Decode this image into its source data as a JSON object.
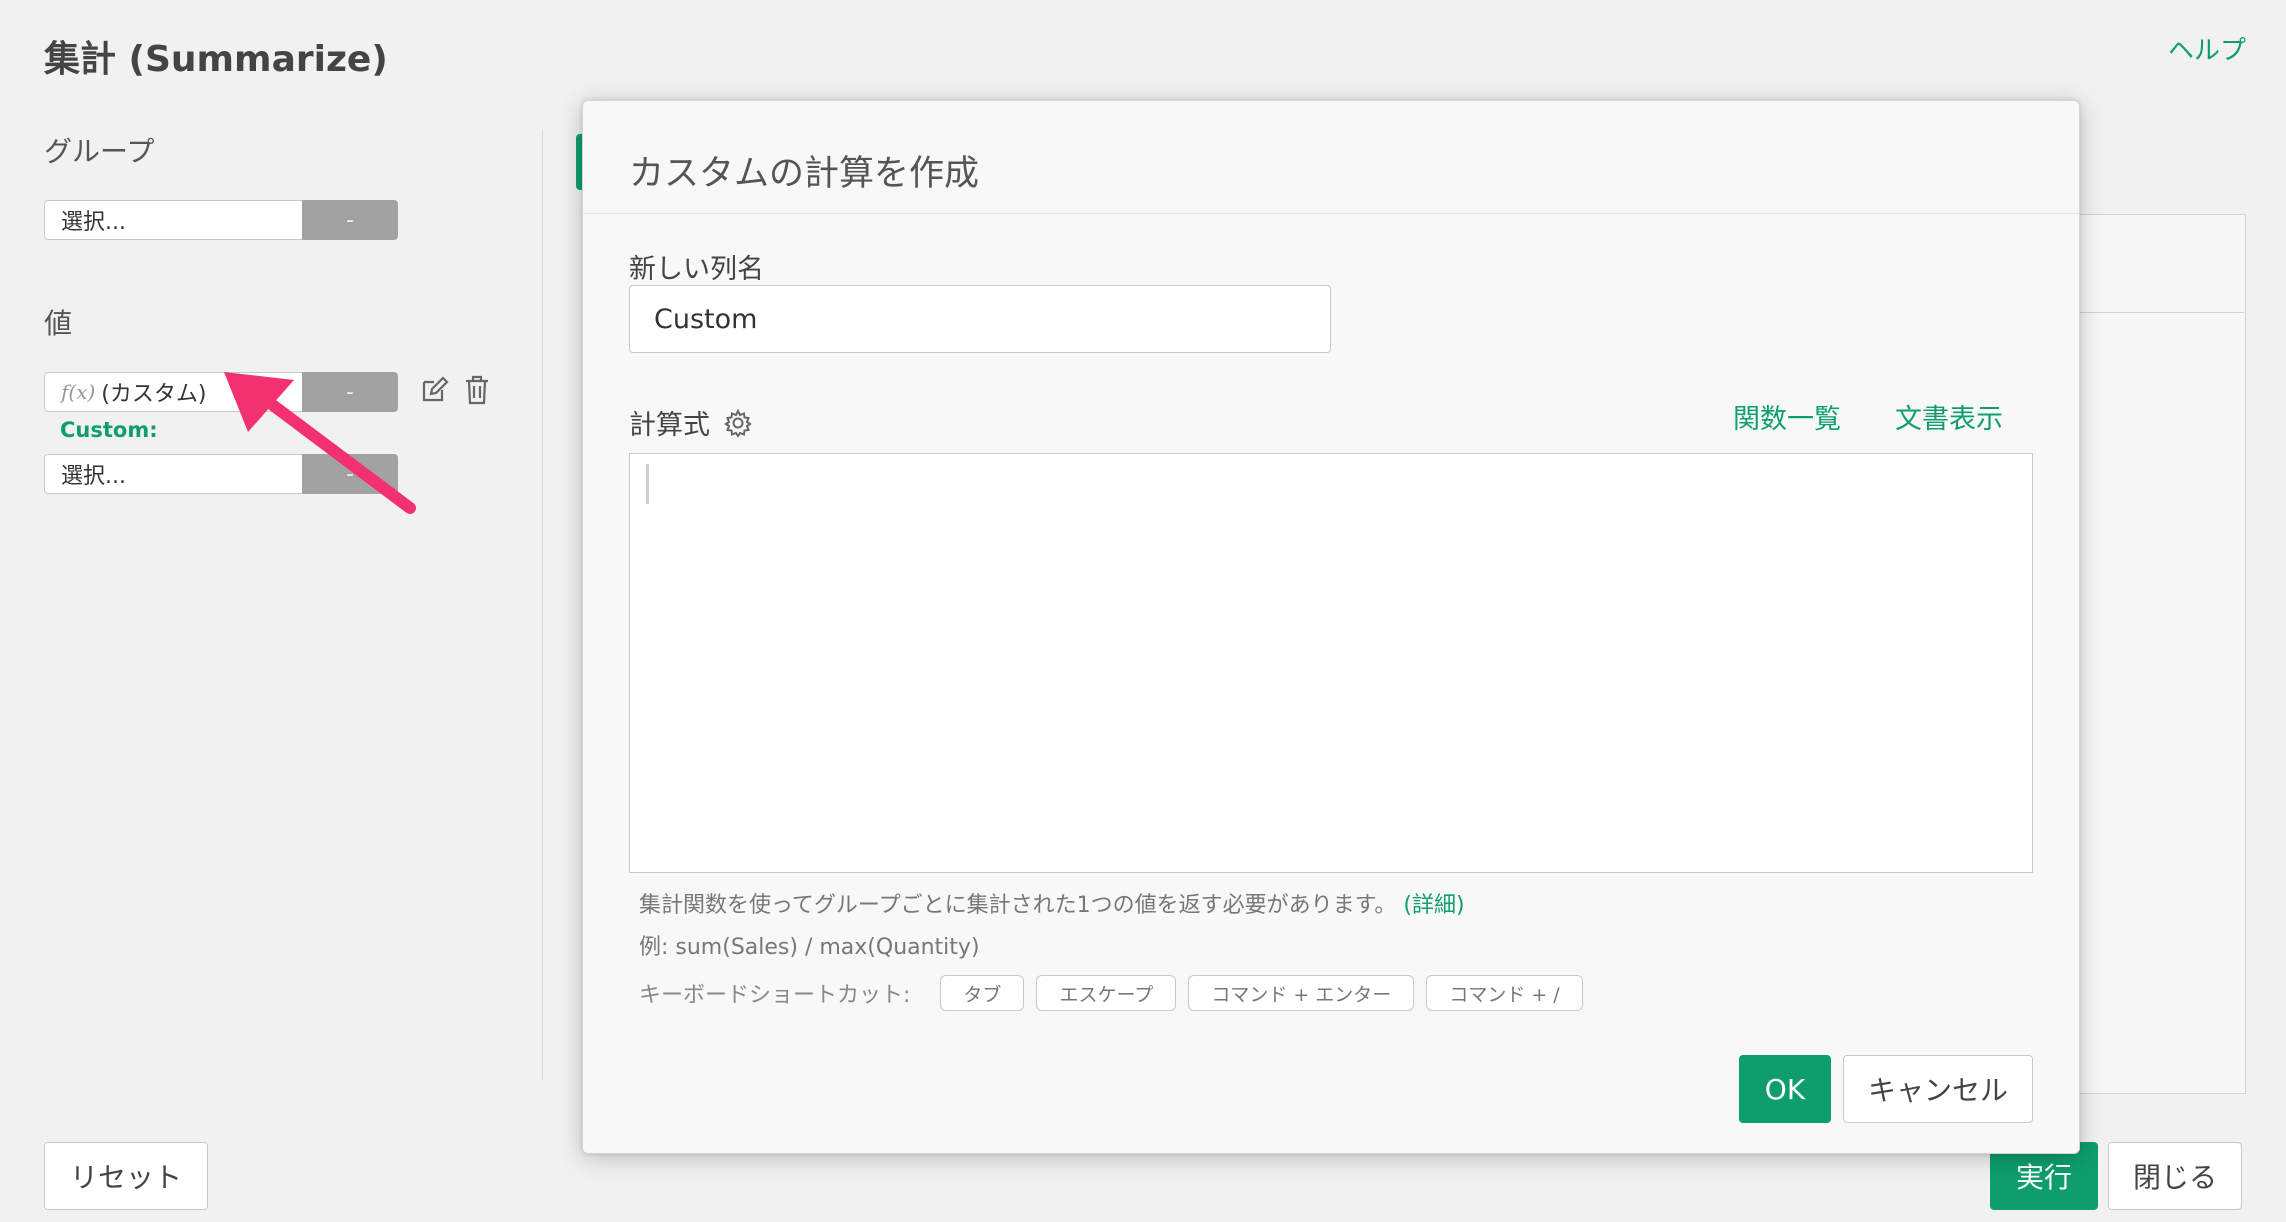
{
  "header": {
    "title": "集計 (Summarize)",
    "help_label": "ヘルプ"
  },
  "left_panel": {
    "group": {
      "label": "グループ",
      "select_value": "選択...",
      "remove_label": "-"
    },
    "value": {
      "label": "値",
      "items": [
        {
          "fx_icon": "f(x)",
          "select_value": "(カスタム)",
          "remove_label": "-",
          "sublabel": "Custom:"
        },
        {
          "select_value": "選択...",
          "remove_label": "-"
        }
      ]
    }
  },
  "footer": {
    "reset_label": "リセット",
    "run_label": "実行",
    "close_label": "閉じる"
  },
  "modal": {
    "title": "カスタムの計算を作成",
    "column_name_label": "新しい列名",
    "column_name_value": "Custom",
    "formula_label": "計算式",
    "function_list_label": "関数一覧",
    "doc_label": "文書表示",
    "hint_text": "集計関数を使ってグループごとに集計された1つの値を返す必要があります。",
    "hint_link": "(詳細)",
    "example_text": "例: sum(Sales) / max(Quantity)",
    "shortcut_label": "キーボードショートカット:",
    "shortcuts": [
      "タブ",
      "エスケープ",
      "コマンド + エンター",
      "コマンド + /"
    ],
    "ok_label": "OK",
    "cancel_label": "キャンセル"
  },
  "colors": {
    "accent": "#0e9e6e",
    "annotation_arrow": "#f3316e",
    "remove_button": "#a2a2a2"
  }
}
